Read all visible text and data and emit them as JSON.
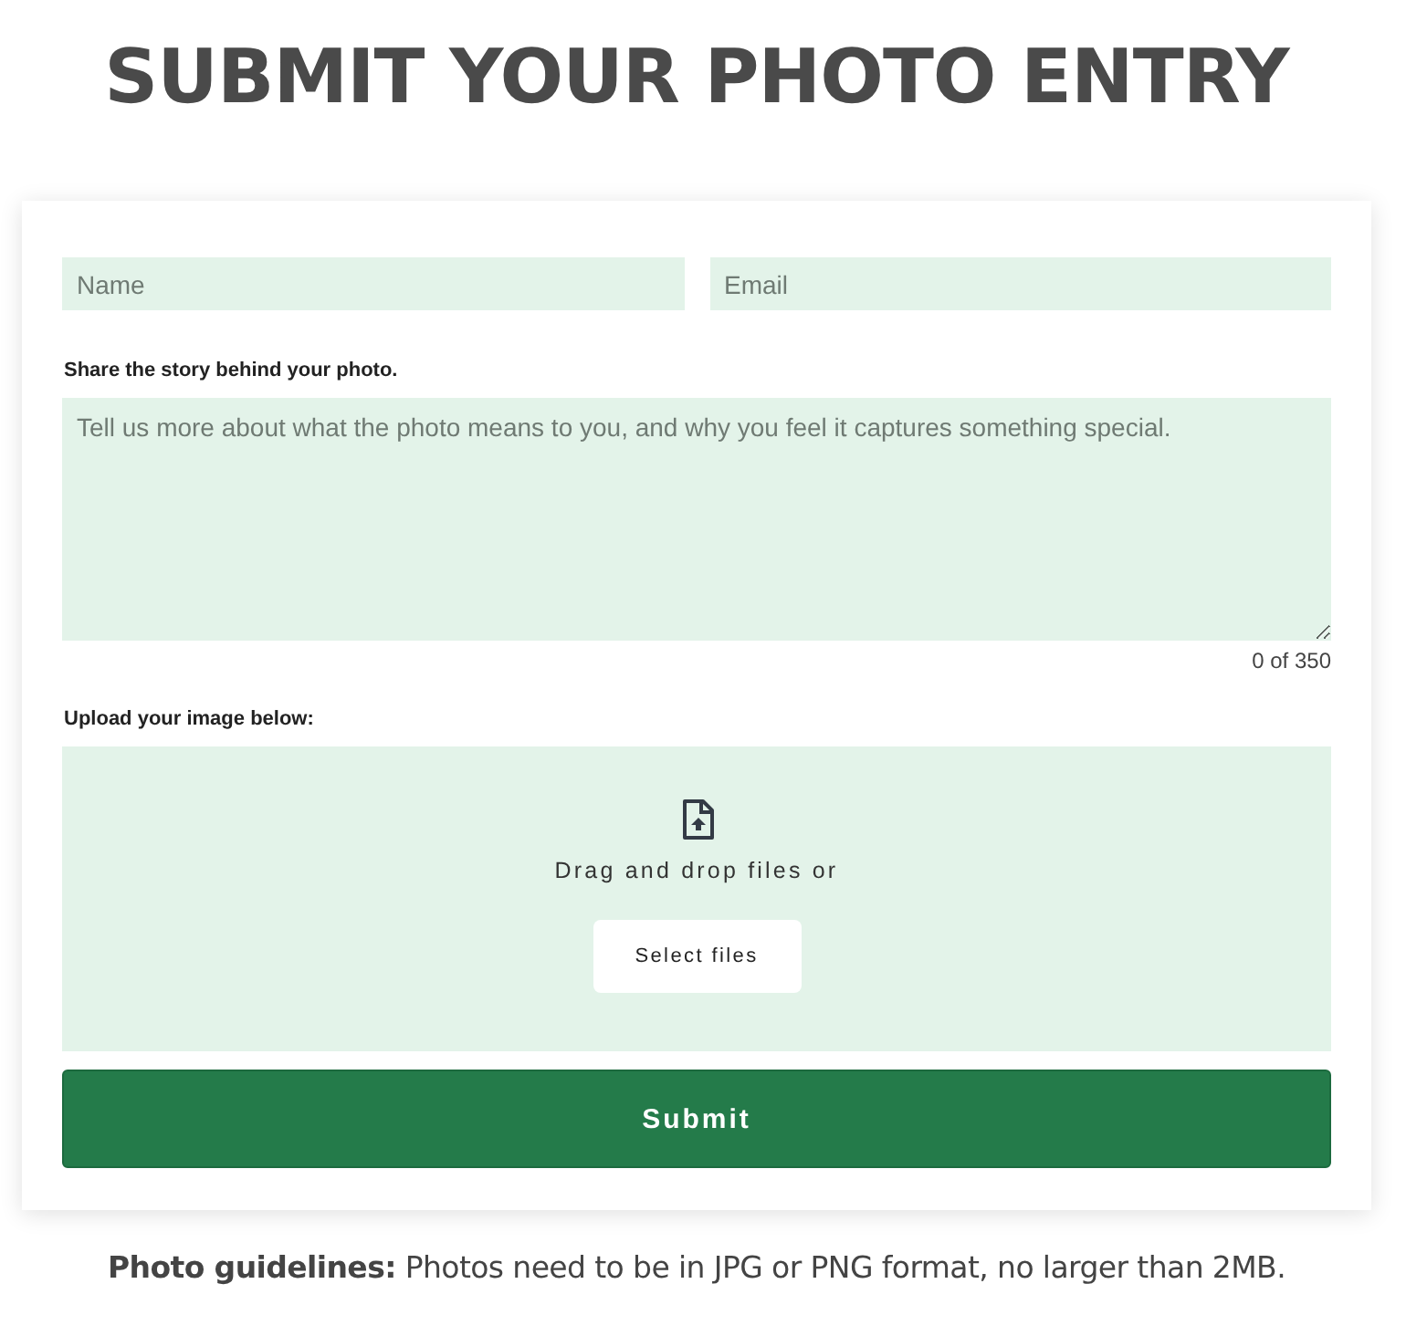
{
  "title": "SUBMIT YOUR PHOTO ENTRY",
  "fields": [
    {
      "placeholder": "Name"
    },
    {
      "placeholder": "Email"
    }
  ],
  "story": {
    "label": "Share the story behind your photo.",
    "placeholder": "Tell us more about what the photo means to you, and why you feel it captures something special.",
    "counter": "0 of 350"
  },
  "upload": {
    "label": "Upload your image below:",
    "prompt": "Drag and drop files or",
    "button": "Select files"
  },
  "submit": "Submit",
  "guidelines": "**Photo guidelines:** Photos need to be in JPG or PNG format, no larger than 2MB."
}
